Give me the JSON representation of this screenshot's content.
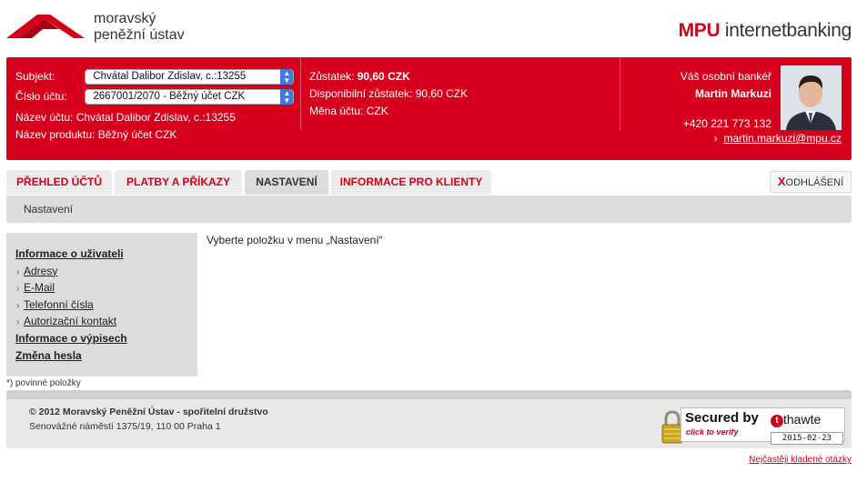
{
  "header": {
    "logo_line1": "moravský",
    "logo_line2": "peněžní ústav",
    "brand_short": "MPU",
    "brand_rest": "internetbanking"
  },
  "account": {
    "subject_label": "Subjekt:",
    "subject_value": "Chvátal Dalibor Zdislav, c.:13255",
    "number_label": "Číslo účtu:",
    "number_value": "2667001/2070 - Běžný účet CZK",
    "name_line": "Název účtu: Chvátal Dalibor Zdislav, c.:13255",
    "product_line": "Název produktu: Běžný účet CZK",
    "balance_label": "Zůstatek:",
    "balance_value": "90,60 CZK",
    "available_label": "Disponibilní zůstatek:",
    "available_value": "90,60 CZK",
    "currency_label": "Měna účtu:",
    "currency_value": "CZK"
  },
  "banker": {
    "title": "Váš osobní bankéř",
    "name": "Martin Markuzi",
    "phone": "+420 221 773 132",
    "email": "martin.markuzi@mpu.cz"
  },
  "tabs": [
    {
      "label": "PŘEHLED ÚČTŮ"
    },
    {
      "label": "PLATBY A PŘÍKAZY"
    },
    {
      "label": "NASTAVENÍ"
    },
    {
      "label": "INFORMACE PRO KLIENTY"
    }
  ],
  "logout": {
    "x": "X",
    "label": "ODHLÁŠENÍ"
  },
  "breadcrumb": "Nastavení",
  "menu": [
    {
      "label": "Informace o uživateli"
    },
    {
      "label": "Adresy"
    },
    {
      "label": "E-Mail"
    },
    {
      "label": "Telefonní čísla"
    },
    {
      "label": "Autorizační kontakt"
    },
    {
      "label": "Informace o výpisech"
    },
    {
      "label": "Změna hesla"
    }
  ],
  "main_message": "Vyberte položku v menu „Nastavení“",
  "required_note": "*) povinné položky",
  "footer": {
    "copyright": "© 2012 Moravský Peněžní Ústav - spořitelní družstvo",
    "address": "Senovážné náměstí 1375/19, 110 00 Praha 1"
  },
  "thawte": {
    "secured": "Secured by",
    "click": "click to verify",
    "brand": "thawte",
    "date": "2015-02-23"
  },
  "faq": "Nejčastěji kladené otázky",
  "colors": {
    "accent": "#d6001c",
    "tab_bg": "#ececec",
    "active_tab": "#dcdcdc"
  }
}
